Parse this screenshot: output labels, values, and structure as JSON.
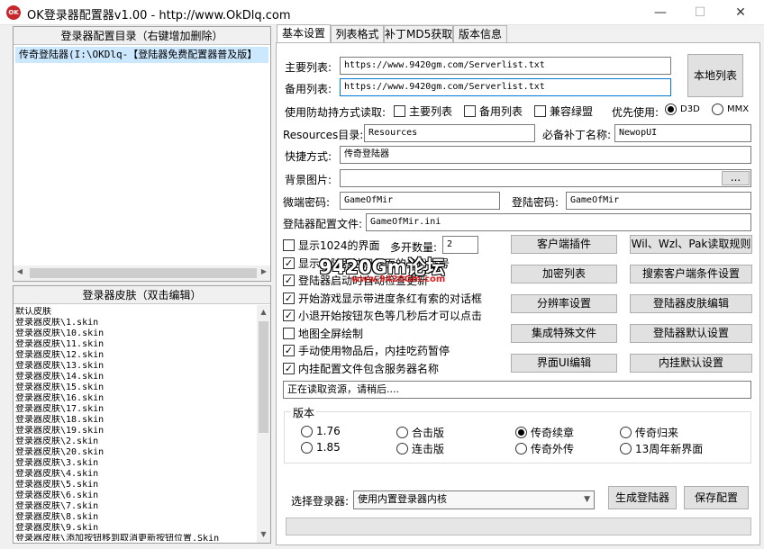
{
  "window": {
    "icon_text": "OK",
    "title": "OK登录器配置器v1.00 - http://www.OkDlq.com",
    "minimize": "—",
    "maximize": "☐",
    "close": "✕"
  },
  "config_panel": {
    "header": "登录器配置目录（右键增加删除）",
    "items": [
      "传奇登陆器(I:\\OKDlq-【登陆器免费配置器普及版】"
    ]
  },
  "skin_panel": {
    "header": "登录器皮肤（双击编辑）",
    "items": [
      "默认皮肤",
      "登录器皮肤\\1.skin",
      "登录器皮肤\\10.skin",
      "登录器皮肤\\11.skin",
      "登录器皮肤\\12.skin",
      "登录器皮肤\\13.skin",
      "登录器皮肤\\14.skin",
      "登录器皮肤\\15.skin",
      "登录器皮肤\\16.skin",
      "登录器皮肤\\17.skin",
      "登录器皮肤\\18.skin",
      "登录器皮肤\\19.skin",
      "登录器皮肤\\2.skin",
      "登录器皮肤\\20.skin",
      "登录器皮肤\\3.skin",
      "登录器皮肤\\4.skin",
      "登录器皮肤\\5.skin",
      "登录器皮肤\\6.skin",
      "登录器皮肤\\7.skin",
      "登录器皮肤\\8.skin",
      "登录器皮肤\\9.skin",
      "登录器皮肤\\添加按钮移到取消更新按钮位置.Skin"
    ]
  },
  "tabs": [
    "基本设置",
    "列表格式",
    "补丁MD5获取",
    "版本信息"
  ],
  "form": {
    "main_list_label": "主要列表:",
    "main_list_value": "https://www.9420gm.com/Serverlist.txt",
    "backup_list_label": "备用列表:",
    "backup_list_value": "https://www.9420gm.com/Serverlist.txt",
    "local_list_button": "本地列表",
    "anti_hijack_label": "使用防劫持方式读取:",
    "anti_hijack_main": "主要列表",
    "anti_hijack_backup": "备用列表",
    "compat_green": "兼容绿盟",
    "priority_label": "优先使用:",
    "priority_d3d": "D3D",
    "priority_mmx": "MMX",
    "resources_label": "Resources目录:",
    "resources_value": "Resources",
    "required_patch_label": "必备补丁名称:",
    "required_patch_value": "NewopUI",
    "shortcut_label": "快捷方式:",
    "shortcut_value": "传奇登陆器",
    "background_label": "背景图片:",
    "background_value": "",
    "browse_button": "...",
    "micro_pwd_label": "微端密码:",
    "micro_pwd_value": "GameOfMir",
    "login_pwd_label": "登陆密码:",
    "login_pwd_value": "GameOfMir",
    "config_file_label": "登陆器配置文件:",
    "config_file_value": "GameOfMir.ini",
    "multi_count_label": "多开数量:",
    "multi_count_value": "2"
  },
  "checkboxes": [
    {
      "label": "显示1024的界面",
      "checked": false
    },
    {
      "label": "显示登陆器注册界面的身份证号",
      "checked": true
    },
    {
      "label": "登陆器启动时自动检查更新",
      "checked": true
    },
    {
      "label": "开始游戏显示带进度条红有索的对话框",
      "checked": true
    },
    {
      "label": "小退开始按钮灰色等几秒后才可以点击",
      "checked": true
    },
    {
      "label": "地图全屏绘制",
      "checked": false
    },
    {
      "label": "手动使用物品后，内挂吃药暂停",
      "checked": true
    },
    {
      "label": "内挂配置文件包含服务器名称",
      "checked": true
    }
  ],
  "action_buttons": [
    [
      "客户端插件",
      "Wil、Wzl、Pak读取规则"
    ],
    [
      "加密列表",
      "搜索客户端条件设置"
    ],
    [
      "分辨率设置",
      "登陆器皮肤编辑"
    ],
    [
      "集成特殊文件",
      "登陆器默认设置"
    ],
    [
      "界面UI编辑",
      "内挂默认设置"
    ]
  ],
  "status_text": "正在读取资源，请稍后....",
  "version": {
    "label": "版本",
    "options": [
      {
        "label": "1.76",
        "selected": false
      },
      {
        "label": "合击版",
        "selected": false
      },
      {
        "label": "传奇续章",
        "selected": true
      },
      {
        "label": "传奇归来",
        "selected": false
      },
      {
        "label": "1.85",
        "selected": false
      },
      {
        "label": "连击版",
        "selected": false
      },
      {
        "label": "传奇外传",
        "selected": false
      },
      {
        "label": "13周年新界面",
        "selected": false
      }
    ]
  },
  "bottom": {
    "select_label": "选择登录器:",
    "select_value": "使用内置登录器内核",
    "generate_button": "生成登陆器",
    "save_button": "保存配置"
  },
  "watermark": {
    "top": "9420Gm论坛",
    "sub": "www.9420Gm.com"
  },
  "colors": {
    "selection": "#cce8ff",
    "focus_border": "#0078d7",
    "icon_red": "#c8262b",
    "watermark_red": "#e02020"
  }
}
